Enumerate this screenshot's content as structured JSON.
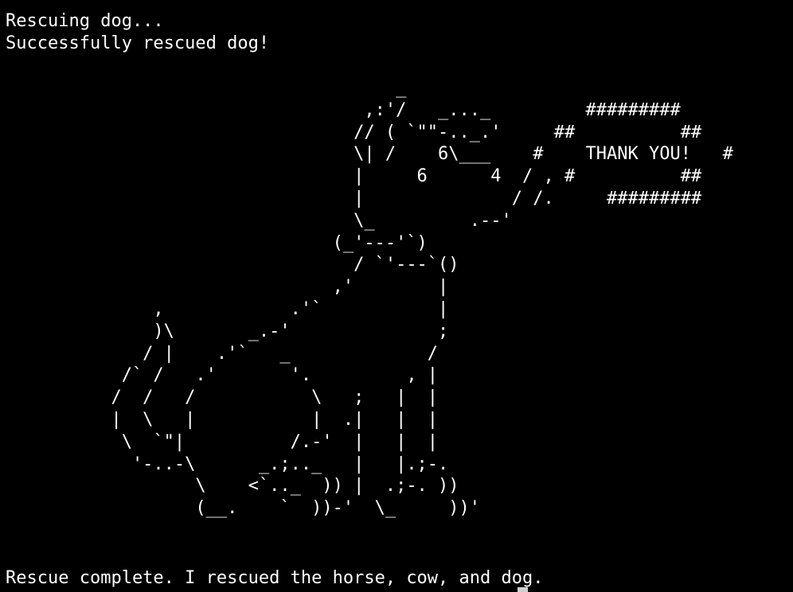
{
  "terminal": {
    "output": [
      "Rescuing dog...",
      "Successfully rescued dog!"
    ],
    "ascii_art": "                                     _\n                                  ,:'/   _..._         #########\n                                 // ( `\"\"-.._.'     ##          ##\n                                 \\| /    6\\___    #    THANK YOU!   #\n                                 |     6      4  / , #          ##\n                                 |              / /.     #########\n                                 \\_         .--'\n                               (_'---'`)\n                                 / `'---`()\n                               ,'        |\n              ,            .'`           |\n              )\\       _.-'              ;\n             / |    .'`   _             /\n           /` /   .'       '.         , |\n          /  /   /           \\   ;   |  |\n          |  \\   |           |  .|   |  |\n           \\  `\"|          /.-'  |   |  |\n            '-..-\\      _.;.._   |   |.;-.\n                  \\    <`.._  )) |  .;-. ))\n                  (__.    `  ))-'  \\_     ))'",
    "final_line": "Rescue complete. I rescued the horse, cow, and dog.",
    "colors": {
      "background": "#000000",
      "text": "#ffffff",
      "cursor": "#cfcfcf"
    }
  }
}
